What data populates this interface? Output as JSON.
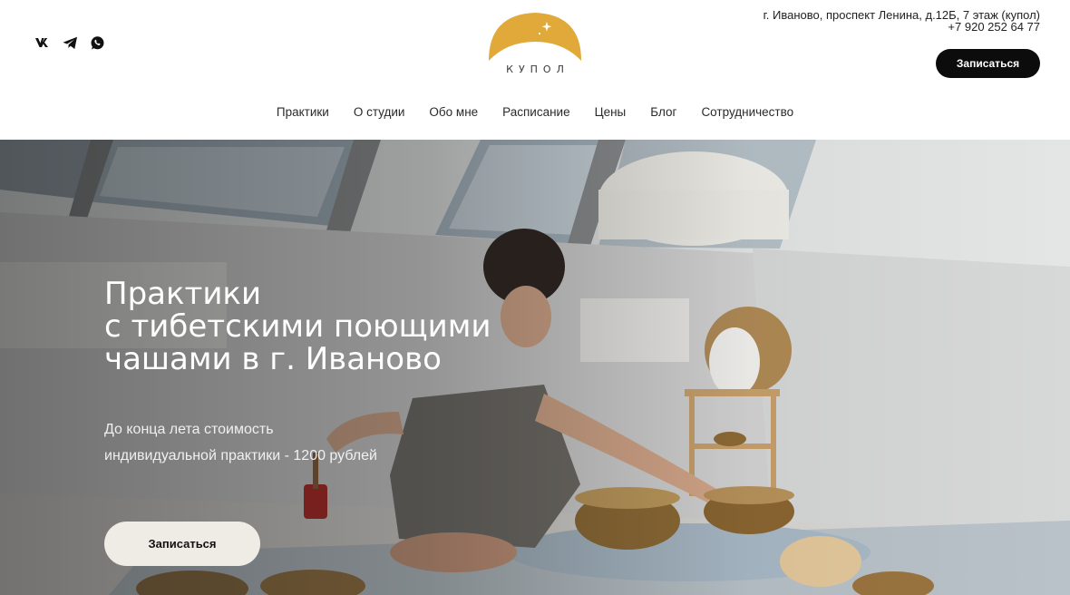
{
  "header": {
    "socials": [
      {
        "icon": "vk-icon"
      },
      {
        "icon": "telegram-icon"
      },
      {
        "icon": "whatsapp-icon"
      }
    ],
    "logo": {
      "word": "КУПОЛ",
      "arc_color": "#e0a93a"
    },
    "contacts": {
      "address": "г. Иваново, проспект Ленина, д.12Б, 7 этаж (купол)",
      "phone": "+7 920 252 64 77"
    },
    "cta_label": "Записаться"
  },
  "nav": {
    "items": [
      "Практики",
      "О студии",
      "Обо мне",
      "Расписание",
      "Цены",
      "Блог",
      "Сотрудничество"
    ]
  },
  "hero": {
    "title_lines": [
      "Практики",
      "с тибетскими поющими",
      "чашами в г. Иваново"
    ],
    "subtitle_lines": [
      "До конца лета стоимость",
      "индивидуальной практики - 1200 рублей"
    ],
    "cta_label": "Записаться"
  },
  "colors": {
    "accent": "#e0a93a",
    "header_button_bg": "#0c0c0c",
    "hero_button_bg": "#efece6"
  }
}
